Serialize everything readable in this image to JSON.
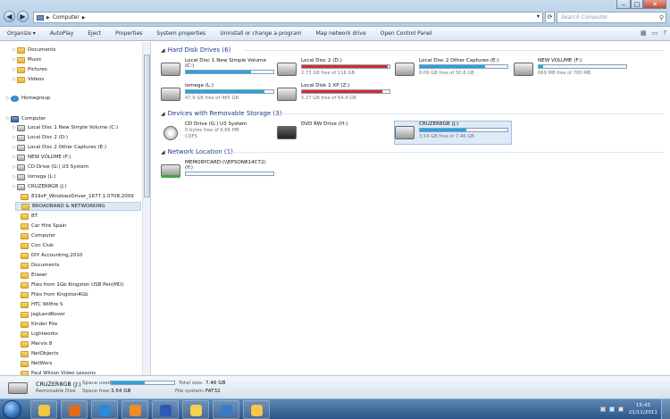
{
  "address": {
    "root_glyph": "▶",
    "crumb": "Computer",
    "arrow": "▶"
  },
  "search_placeholder": "Search Computer",
  "caption": {
    "min": "–",
    "max": "□",
    "close": "✕"
  },
  "toolbar": {
    "items": [
      "Organize ▾",
      "AutoPlay",
      "Eject",
      "Properties",
      "System properties",
      "Uninstall or change a program",
      "Map network drive",
      "Open Control Panel"
    ]
  },
  "nav": {
    "items": [
      {
        "label": "Documents",
        "icon": "folder",
        "indent": 1
      },
      {
        "label": "Music",
        "icon": "folder",
        "indent": 1
      },
      {
        "label": "Pictures",
        "icon": "folder",
        "indent": 1
      },
      {
        "label": "Videos",
        "icon": "folder",
        "indent": 1
      },
      {
        "label": "Homegroup",
        "icon": "homegroup",
        "indent": 0
      },
      {
        "label": "Computer",
        "icon": "computer",
        "indent": 0
      },
      {
        "label": "Local Disc 1 New Simple Volume (C:)",
        "icon": "drive",
        "indent": 1
      },
      {
        "label": "Local Disc 2 (D:)",
        "icon": "drive",
        "indent": 1
      },
      {
        "label": "Local Disc 2 Other Captures (E:)",
        "icon": "drive",
        "indent": 1
      },
      {
        "label": "NEW VOLUME (F:)",
        "icon": "drive",
        "indent": 1
      },
      {
        "label": "CD Drive (G:) U3 System",
        "icon": "drive",
        "indent": 1
      },
      {
        "label": "Iomega (L:)",
        "icon": "drive",
        "indent": 1
      },
      {
        "label": "CRUZER8GB (J:)",
        "icon": "drive",
        "indent": 1
      },
      {
        "label": "819xP_WindowsDriver_1677.1.0708.2009",
        "icon": "folder",
        "indent": 2
      },
      {
        "label": "BROADBAND & NETWORKING",
        "icon": "folder",
        "indent": 2
      },
      {
        "label": "BT",
        "icon": "folder",
        "indent": 2
      },
      {
        "label": "Car Hire Spain",
        "icon": "folder",
        "indent": 2
      },
      {
        "label": "Computer",
        "icon": "folder",
        "indent": 2
      },
      {
        "label": "Con Club",
        "icon": "folder",
        "indent": 2
      },
      {
        "label": "DIY Accounting,2010",
        "icon": "folder",
        "indent": 2
      },
      {
        "label": "Documents",
        "icon": "folder",
        "indent": 2
      },
      {
        "label": "Eraser",
        "icon": "folder",
        "indent": 2
      },
      {
        "label": "Files from 1Gb Kingston USB Pen(MD)",
        "icon": "folder",
        "indent": 2
      },
      {
        "label": "Files from Kingston4Gb",
        "icon": "folder",
        "indent": 2
      },
      {
        "label": "HTC Wilfire S",
        "icon": "folder",
        "indent": 2
      },
      {
        "label": "JagLandRover",
        "icon": "folder",
        "indent": 2
      },
      {
        "label": "Kinder Fire",
        "icon": "folder",
        "indent": 2
      },
      {
        "label": "Lightworks",
        "icon": "folder",
        "indent": 2
      },
      {
        "label": "Mervis 8",
        "icon": "folder",
        "indent": 2
      },
      {
        "label": "NetObjects",
        "icon": "folder",
        "indent": 2
      },
      {
        "label": "NetWorx",
        "icon": "folder",
        "indent": 2
      },
      {
        "label": "Paul Wilson Video Lessons",
        "icon": "folder",
        "indent": 2
      }
    ]
  },
  "groups": {
    "hdd": {
      "title": "Hard Disk Drives (6)"
    },
    "removable": {
      "title": "Devices with Removable Storage (3)"
    },
    "network": {
      "title": "Network Location (1)"
    }
  },
  "hdd_tiles": [
    {
      "name": "Local Disc 1 New Simple Volume",
      "name2": "(C:)",
      "sub": "",
      "used_fraction": 0.74,
      "color": "#2aa3dd"
    },
    {
      "name": "Local Disc 2 (D:)",
      "sub": "2.73 GB free of 116 GB",
      "used_fraction": 0.98,
      "color": "#d82a2a"
    },
    {
      "name": "Local Disc 2 Other Captures (E:)",
      "sub": "8.09 GB free of 30.8 GB",
      "used_fraction": 0.74,
      "color": "#2aa3dd"
    },
    {
      "name": "NEW VOLUME (F:)",
      "sub": "669 MB free of 700 MB",
      "used_fraction": 0.05,
      "color": "#2aa3dd"
    },
    {
      "name": "Iomega (L:)",
      "sub": "47.9 GB free of 465 GB",
      "used_fraction": 0.9,
      "color": "#2aa3dd"
    },
    {
      "name": "Local Disk 1 XP (Z:)",
      "sub": "5.27 GB free of 64.4 GB",
      "used_fraction": 0.92,
      "color": "#d82a2a"
    }
  ],
  "removable_tiles": [
    {
      "name": "CD Drive (G:) U3 System",
      "sub": "0 bytes free of 6.66 MB",
      "sub2": "CDFS"
    },
    {
      "name": "DVD RW Drive (H:)",
      "sub": "",
      "sub2": ""
    },
    {
      "name": "CRUZER8GB (J:)",
      "sub": "3.54 GB free of 7.46 GB",
      "used_fraction": 0.53,
      "color": "#2aa3dd"
    }
  ],
  "network_tiles": [
    {
      "name": "MEMORYCARD (\\\\EPSON814C72)",
      "name2": "(Y:)",
      "used_fraction": 0.0,
      "color": "#2aa3dd"
    }
  ],
  "details": {
    "name": "CRUZER8GB (J:)",
    "type": "Removable Disk",
    "space_used_label": "Space used:",
    "space_used_fraction": 0.53,
    "space_free_label": "Space free:",
    "space_free": "3.54 GB",
    "total_size_label": "Total size:",
    "total_size": "7.46 GB",
    "file_system_label": "File system:",
    "file_system": "FAT32"
  },
  "clock": {
    "time": "15:43",
    "date": "21/11/2011"
  },
  "taskbar_apps": [
    {
      "name": "explorer",
      "color": "#f2c744"
    },
    {
      "name": "firefox",
      "color": "#e06b1f"
    },
    {
      "name": "ie",
      "color": "#2a8ad6"
    },
    {
      "name": "media-player",
      "color": "#f08c23"
    },
    {
      "name": "word",
      "color": "#2b5bb5"
    },
    {
      "name": "notes",
      "color": "#f3d24d"
    },
    {
      "name": "thunderbird",
      "color": "#3b7bc4"
    },
    {
      "name": "app",
      "color": "#f6c54a"
    }
  ]
}
